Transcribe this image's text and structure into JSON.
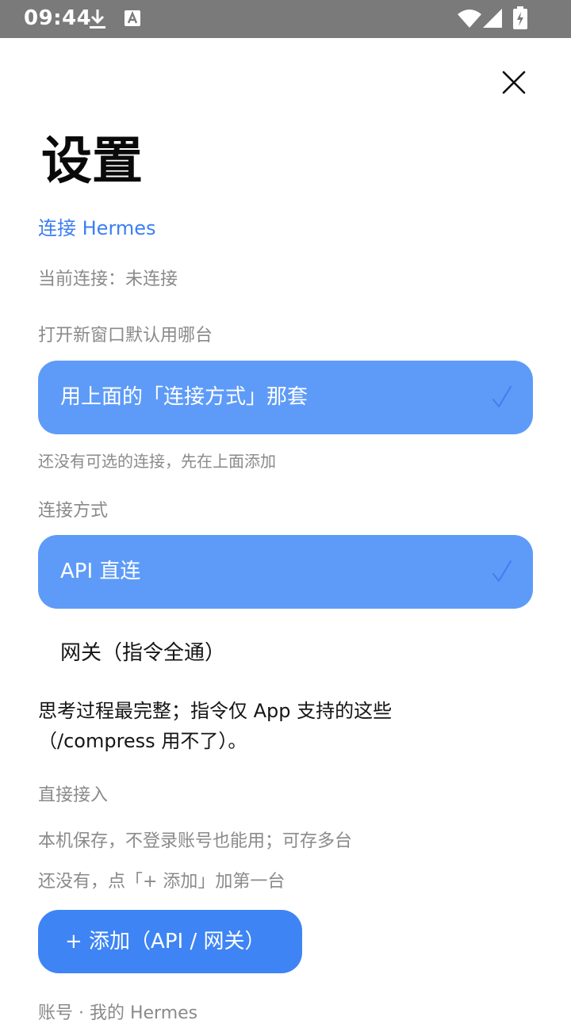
{
  "status_bar": {
    "time": "09:44",
    "icons": [
      "download-icon",
      "text-a-icon",
      "wifi-icon",
      "signal-icon",
      "battery-charging-icon"
    ]
  },
  "header": {
    "close_icon": "close-icon",
    "title": "设置"
  },
  "connection": {
    "section_label": "连接 Hermes",
    "current_status": "当前连接：未连接"
  },
  "default_window": {
    "label": "打开新窗口默认用哪台",
    "selected_option": "用上面的「连接方式」那套",
    "hint": "还没有可选的连接，先在上面添加"
  },
  "connection_method": {
    "label": "连接方式",
    "options": [
      {
        "label": "API 直连",
        "selected": true
      },
      {
        "label": "网关（指令全通）",
        "selected": false
      }
    ],
    "description": "思考过程最完整；指令仅 App 支持的这些（/compress 用不了）。"
  },
  "direct_access": {
    "label": "直接接入",
    "description": "本机保存，不登录账号也能用；可存多台",
    "empty_hint": "还没有，点「+ 添加」加第一台",
    "add_button": "+ 添加（API / 网关）"
  },
  "account": {
    "line": "账号 · 我的 Hermes"
  },
  "colors": {
    "accent": "#3e84f5",
    "selected_bg": "#5e9bf8",
    "link": "#3b7ff2",
    "muted_text": "#8a8a8a",
    "status_bar": "#7a7a7a"
  }
}
